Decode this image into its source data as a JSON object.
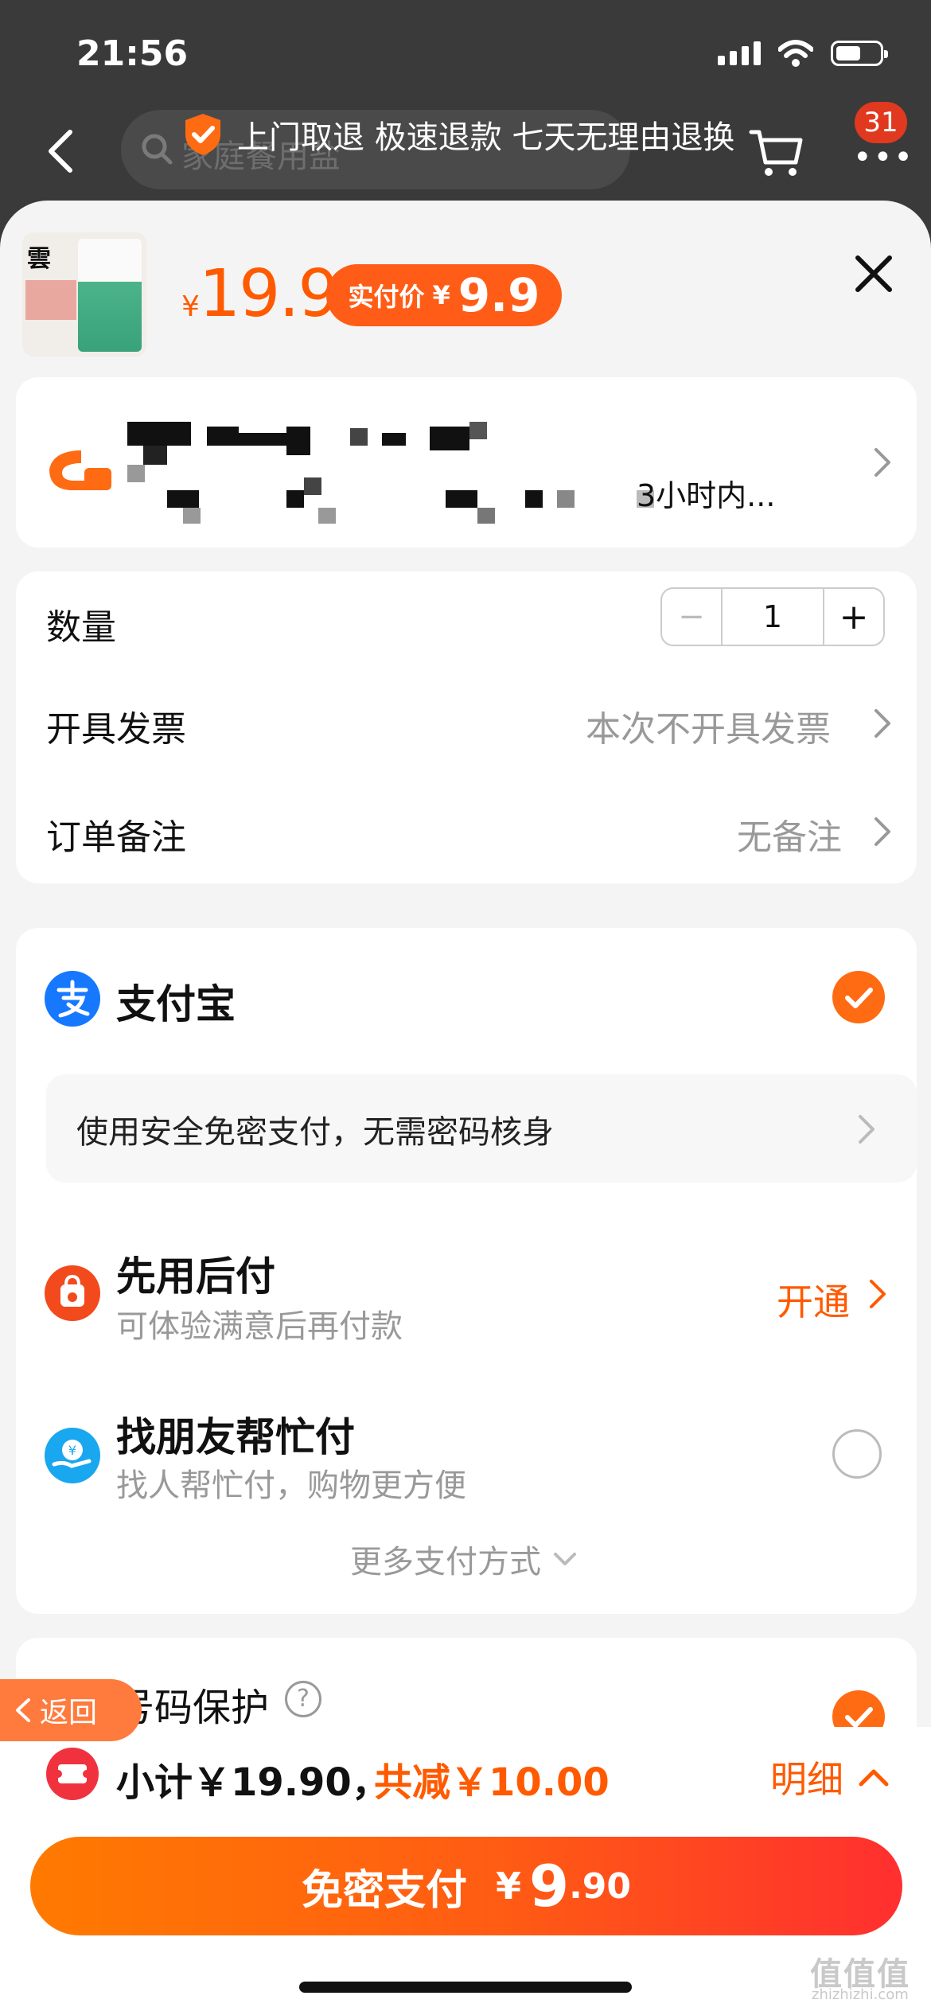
{
  "status_bar": {
    "time": "21:56"
  },
  "nav": {
    "search_placeholder": "家庭餐用盐",
    "banner": "上门取退 极速退款 七天无理由退换",
    "cart_badge": "31"
  },
  "product": {
    "price_symbol": "¥",
    "price": "19.9",
    "real_price_label": "实付价",
    "real_price_symbol": "¥",
    "real_price": "9.9"
  },
  "address": {
    "tail_text": "3小时内..."
  },
  "order": {
    "quantity_label": "数量",
    "quantity_minus": "−",
    "quantity_value": "1",
    "quantity_plus": "+",
    "invoice_label": "开具发票",
    "invoice_value": "本次不开具发票",
    "note_label": "订单备注",
    "note_value": "无备注"
  },
  "payment": {
    "alipay_label": "支付宝",
    "mianmi_text": "使用安全免密支付，无需密码核身",
    "later_title": "先用后付",
    "later_sub": "可体验满意后再付款",
    "later_action": "开通",
    "friend_title": "找朋友帮忙付",
    "friend_sub": "找人帮忙付，购物更方便",
    "more_label": "更多支付方式"
  },
  "protection": {
    "title": "号码保护",
    "help": "?"
  },
  "back_button": {
    "label": "返回"
  },
  "summary": {
    "subtotal": "小计￥19.90，",
    "reduce": "共减￥10.00",
    "detail": "明细"
  },
  "pay_button": {
    "label": "免密支付",
    "symbol": "¥",
    "integer": "9",
    "decimal": ".90"
  },
  "watermark": {
    "cn": "值值值",
    "url": "zhizhizhi.com"
  },
  "colors": {
    "accent": "#ff5a00",
    "alipay_blue": "#1677ff"
  }
}
